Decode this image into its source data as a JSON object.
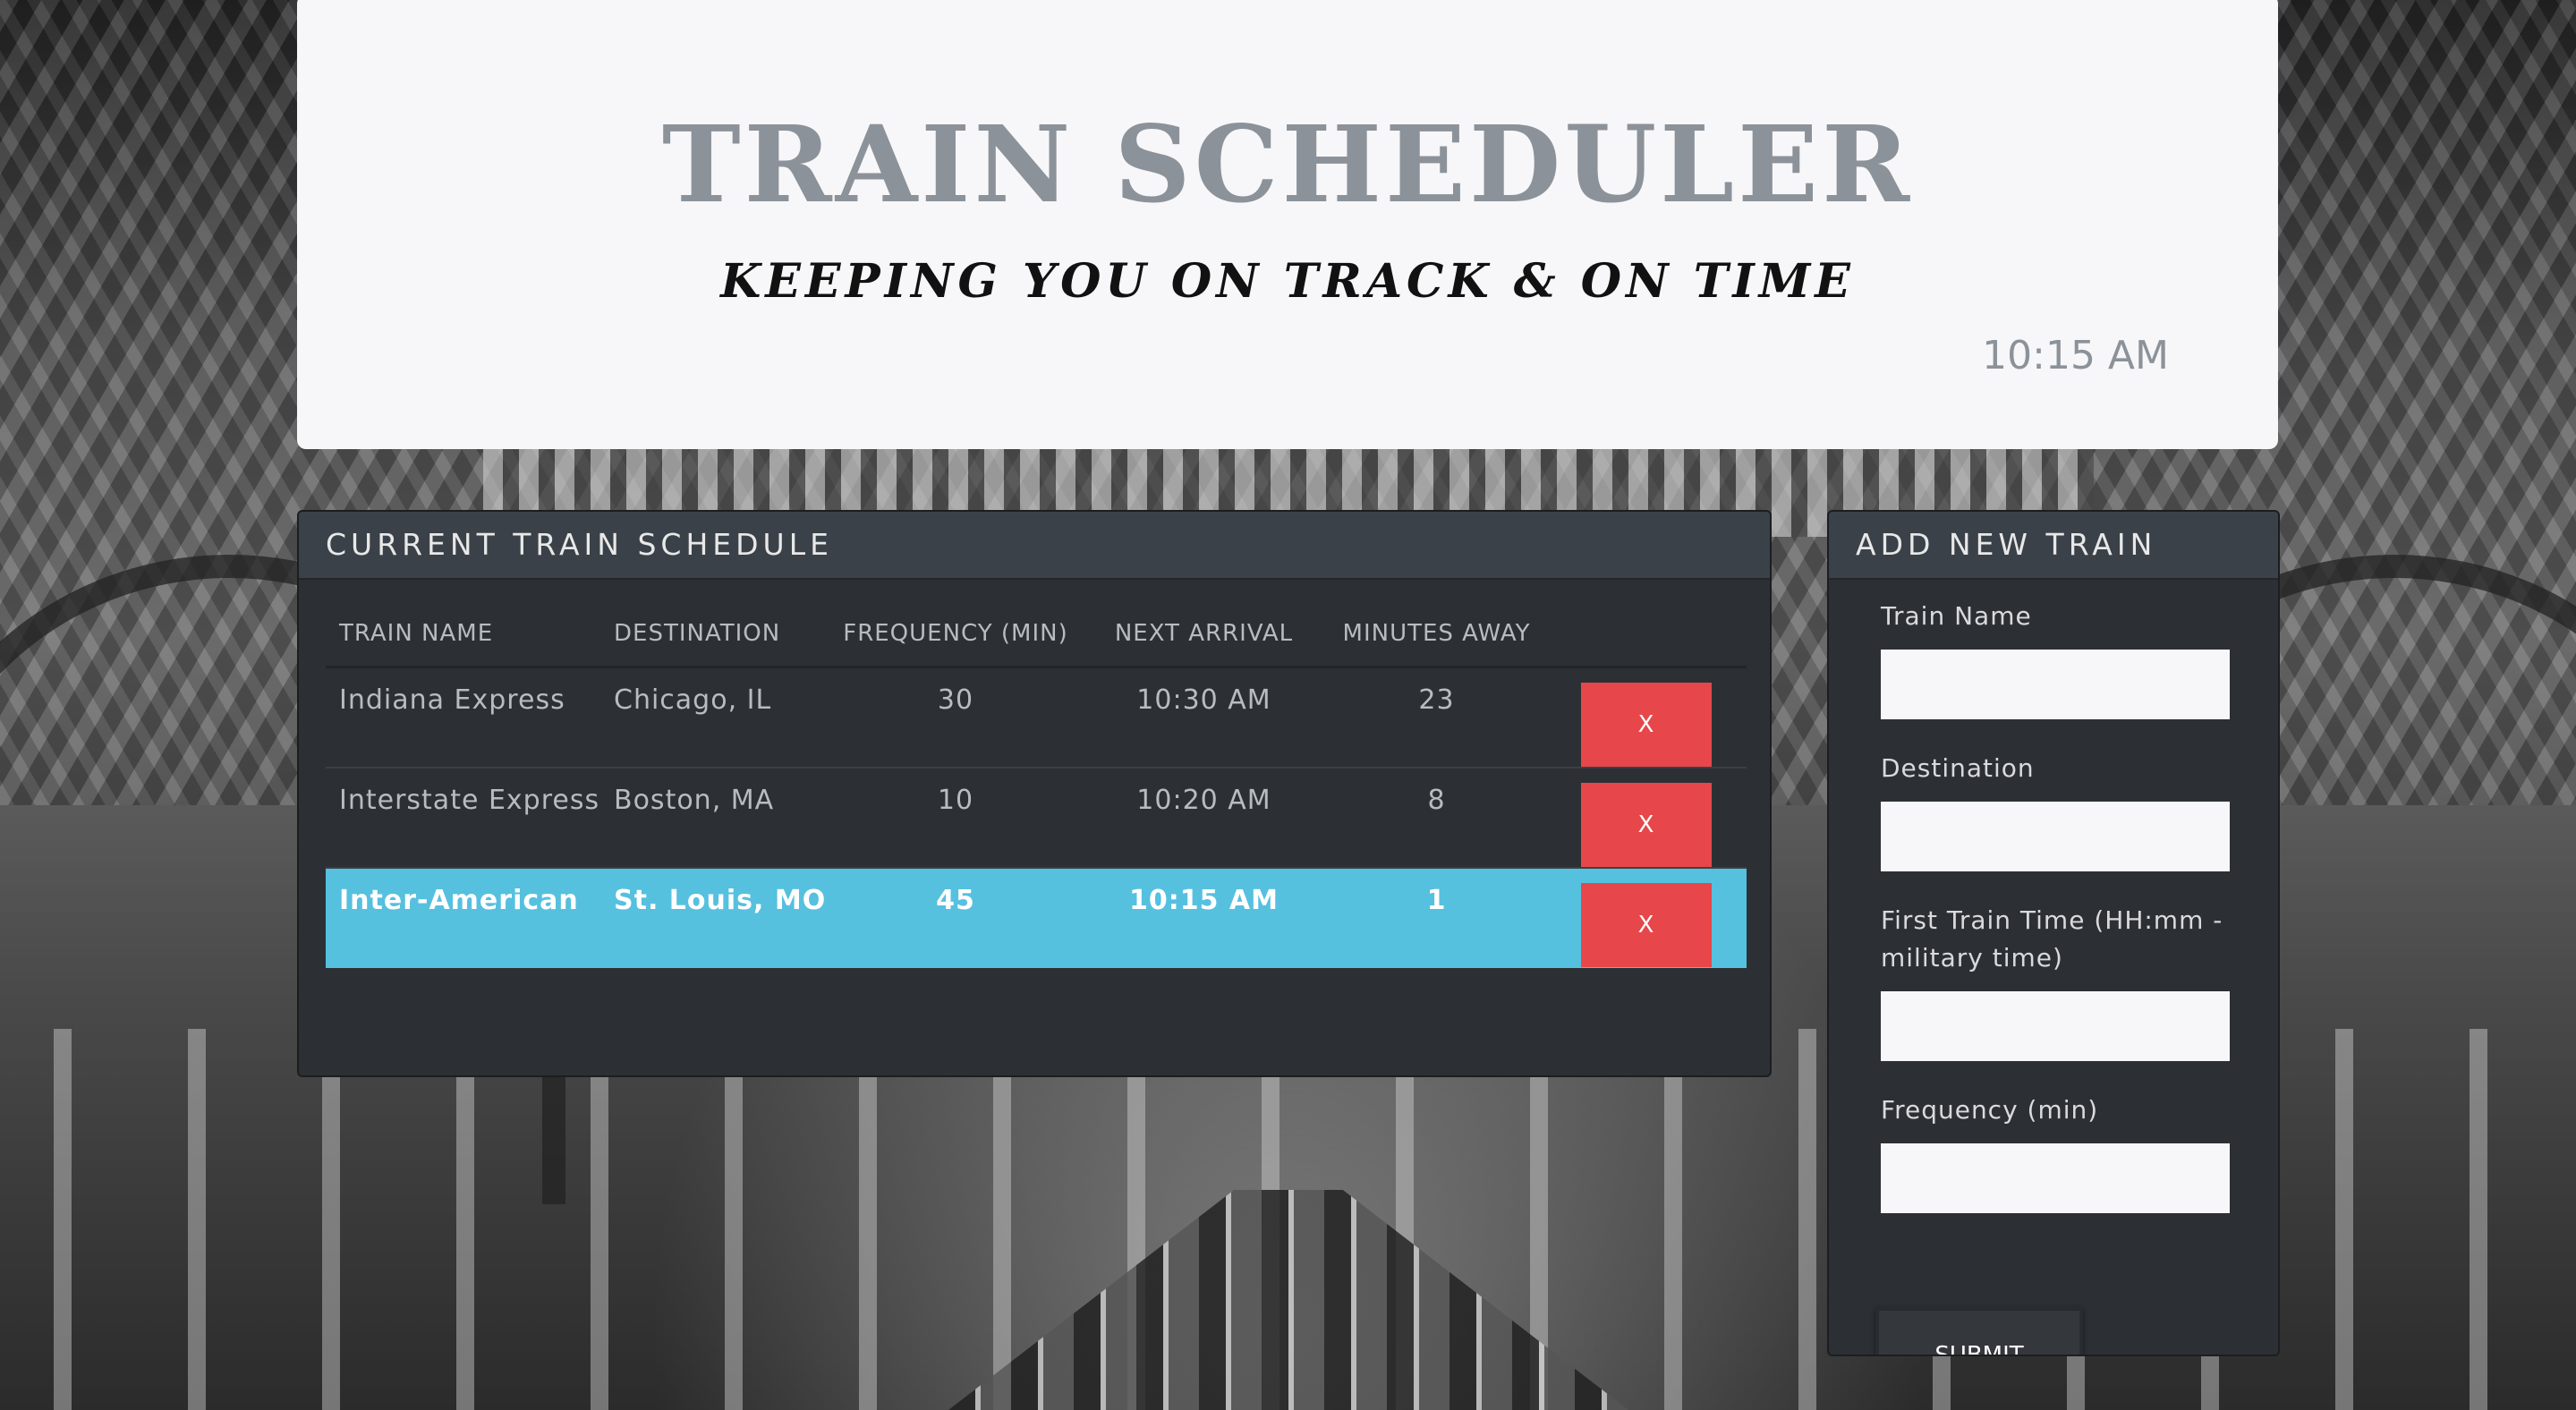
{
  "header": {
    "title": "TRAIN SCHEDULER",
    "subtitle": "KEEPING YOU ON TRACK & ON TIME",
    "current_time": "10:15 AM"
  },
  "schedule": {
    "heading": "CURRENT TRAIN SCHEDULE",
    "columns": [
      "TRAIN NAME",
      "DESTINATION",
      "FREQUENCY (MIN)",
      "NEXT ARRIVAL",
      "MINUTES AWAY"
    ],
    "rows": [
      {
        "name": "Indiana Express",
        "destination": "Chicago, IL",
        "frequency": "30",
        "next_arrival": "10:30 AM",
        "minutes_away": "23",
        "delete_label": "X"
      },
      {
        "name": "Interstate Express",
        "destination": "Boston, MA",
        "frequency": "10",
        "next_arrival": "10:20 AM",
        "minutes_away": "8",
        "delete_label": "X"
      },
      {
        "name": "Inter-American",
        "destination": "St. Louis, MO",
        "frequency": "45",
        "next_arrival": "10:15 AM",
        "minutes_away": "1",
        "delete_label": "X"
      }
    ],
    "highlighted_row": 2
  },
  "form": {
    "heading": "ADD NEW TRAIN",
    "train_name_label": "Train Name",
    "train_name_value": "",
    "destination_label": "Destination",
    "destination_value": "",
    "first_time_label": "First Train Time (HH:mm - military time)",
    "first_time_value": "",
    "frequency_label": "Frequency (min)",
    "frequency_value": "",
    "submit_label": "SUBMIT"
  },
  "colors": {
    "highlight": "#56c0df",
    "delete": "#e7474a",
    "card": "#2c3035",
    "card_header": "#3b4148"
  }
}
